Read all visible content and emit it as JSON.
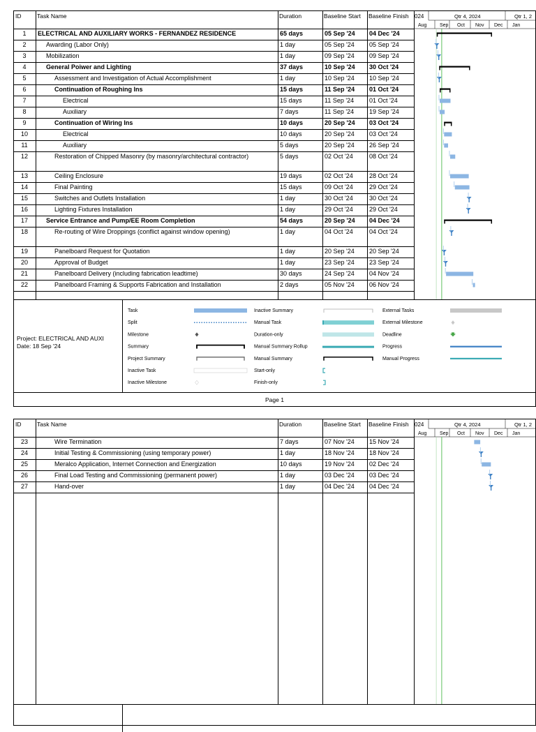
{
  "columns": {
    "id": "ID",
    "name": "Task Name",
    "duration": "Duration",
    "bstart": "Baseline Start",
    "bfinish": "Baseline Finish"
  },
  "timescale": {
    "top_left": "024",
    "top_mid": "Qtr 4, 2024",
    "top_right": "Qtr 1, 2",
    "months": [
      "Aug",
      "Sep",
      "Oct",
      "Nov",
      "Dec",
      "Jan"
    ]
  },
  "page1_tasks": [
    {
      "id": "1",
      "name": "ELECTRICAL AND AUXILIARY WORKS - FERNANDEZ RESIDENCE",
      "duration": "65 days",
      "bstart": "05 Sep '24",
      "bfinish": "04 Dec '24",
      "bold": true,
      "indent": 0
    },
    {
      "id": "2",
      "name": "Awarding (Labor Only)",
      "duration": "1 day",
      "bstart": "05 Sep '24",
      "bfinish": "05 Sep '24",
      "bold": false,
      "indent": 1
    },
    {
      "id": "3",
      "name": "Mobilization",
      "duration": "1 day",
      "bstart": "09 Sep '24",
      "bfinish": "09 Sep '24",
      "bold": false,
      "indent": 1
    },
    {
      "id": "4",
      "name": "General Poiwer and Lighting",
      "duration": "37 days",
      "bstart": "10 Sep '24",
      "bfinish": "30 Oct '24",
      "bold": true,
      "indent": 1
    },
    {
      "id": "5",
      "name": "Assessment and Investigation of Actual Accomplishment",
      "duration": "1 day",
      "bstart": "10 Sep '24",
      "bfinish": "10 Sep '24",
      "bold": false,
      "indent": 2
    },
    {
      "id": "6",
      "name": "Continuation of Roughing Ins",
      "duration": "15 days",
      "bstart": "11 Sep '24",
      "bfinish": "01 Oct '24",
      "bold": true,
      "indent": 2
    },
    {
      "id": "7",
      "name": "Electrical",
      "duration": "15 days",
      "bstart": "11 Sep '24",
      "bfinish": "01 Oct '24",
      "bold": false,
      "indent": 3
    },
    {
      "id": "8",
      "name": "Auxiliary",
      "duration": "7 days",
      "bstart": "11 Sep '24",
      "bfinish": "19 Sep '24",
      "bold": false,
      "indent": 3
    },
    {
      "id": "9",
      "name": "Continuation of Wiring Ins",
      "duration": "10 days",
      "bstart": "20 Sep '24",
      "bfinish": "03 Oct '24",
      "bold": true,
      "indent": 2
    },
    {
      "id": "10",
      "name": "Electrical",
      "duration": "10 days",
      "bstart": "20 Sep '24",
      "bfinish": "03 Oct '24",
      "bold": false,
      "indent": 3
    },
    {
      "id": "11",
      "name": "Auxiliary",
      "duration": "5 days",
      "bstart": "20 Sep '24",
      "bfinish": "26 Sep '24",
      "bold": false,
      "indent": 3
    },
    {
      "id": "12",
      "name": "Restoration of Chipped Masonry (by masonry/architectural contractor)",
      "duration": "5 days",
      "bstart": "02 Oct '24",
      "bfinish": "08 Oct '24",
      "bold": false,
      "indent": 2,
      "tall": true
    },
    {
      "id": "13",
      "name": "Ceiling Enclosure",
      "duration": "19 days",
      "bstart": "02 Oct '24",
      "bfinish": "28 Oct '24",
      "bold": false,
      "indent": 2
    },
    {
      "id": "14",
      "name": "Final Painting",
      "duration": "15 days",
      "bstart": "09 Oct '24",
      "bfinish": "29 Oct '24",
      "bold": false,
      "indent": 2
    },
    {
      "id": "15",
      "name": "Switches and Outlets Installation",
      "duration": "1 day",
      "bstart": "30 Oct '24",
      "bfinish": "30 Oct '24",
      "bold": false,
      "indent": 2
    },
    {
      "id": "16",
      "name": "Lighting Fixtures Installation",
      "duration": "1 day",
      "bstart": "29 Oct '24",
      "bfinish": "29 Oct '24",
      "bold": false,
      "indent": 2
    },
    {
      "id": "17",
      "name": "Service Entrance and Pump/EE Room Completion",
      "duration": "54 days",
      "bstart": "20 Sep '24",
      "bfinish": "04 Dec '24",
      "bold": true,
      "indent": 1
    },
    {
      "id": "18",
      "name": "Re-routing of Wire Droppings (conflict against window opening)",
      "duration": "1 day",
      "bstart": "04 Oct '24",
      "bfinish": "04 Oct '24",
      "bold": false,
      "indent": 2,
      "tall": true
    },
    {
      "id": "19",
      "name": "Panelboard Request for Quotation",
      "duration": "1 day",
      "bstart": "20 Sep '24",
      "bfinish": "20 Sep '24",
      "bold": false,
      "indent": 2
    },
    {
      "id": "20",
      "name": "Approval of Budget",
      "duration": "1 day",
      "bstart": "23 Sep '24",
      "bfinish": "23 Sep '24",
      "bold": false,
      "indent": 2
    },
    {
      "id": "21",
      "name": "Panelboard Delivery (including fabrication leadtime)",
      "duration": "30 days",
      "bstart": "24 Sep '24",
      "bfinish": "04 Nov '24",
      "bold": false,
      "indent": 2
    },
    {
      "id": "22",
      "name": "Panelboard Framing & Supports Fabrication and Installation",
      "duration": "2 days",
      "bstart": "05 Nov '24",
      "bfinish": "06 Nov '24",
      "bold": false,
      "indent": 2
    }
  ],
  "page2_tasks": [
    {
      "id": "23",
      "name": "Wire Termination",
      "duration": "7 days",
      "bstart": "07 Nov '24",
      "bfinish": "15 Nov '24",
      "bold": false,
      "indent": 2
    },
    {
      "id": "24",
      "name": "Initial Testing & Commissioning (using temporary power)",
      "duration": "1 day",
      "bstart": "18 Nov '24",
      "bfinish": "18 Nov '24",
      "bold": false,
      "indent": 2
    },
    {
      "id": "25",
      "name": "Meralco Application, Internet Connection and Energization",
      "duration": "10 days",
      "bstart": "19 Nov '24",
      "bfinish": "02 Dec '24",
      "bold": false,
      "indent": 2
    },
    {
      "id": "26",
      "name": "Final Load Testing and Commissioning (permanent power)",
      "duration": "1 day",
      "bstart": "03 Dec '24",
      "bfinish": "03 Dec '24",
      "bold": false,
      "indent": 2
    },
    {
      "id": "27",
      "name": "Hand-over",
      "duration": "1 day",
      "bstart": "04 Dec '24",
      "bfinish": "04 Dec '24",
      "bold": false,
      "indent": 2
    }
  ],
  "legend": {
    "project": "Project: ELECTRICAL AND AUXI",
    "date": "Date: 18 Sep '24",
    "col1": [
      "Task",
      "Split",
      "Milestone",
      "Summary",
      "Project Summary",
      "Inactive Task",
      "Inactive Milestone"
    ],
    "col2": [
      "Inactive Summary",
      "Manual Task",
      "Duration-only",
      "Manual Summary Rollup",
      "Manual Summary",
      "Start-only",
      "Finish-only"
    ],
    "col3": [
      "External Tasks",
      "External Milestone",
      "Deadline",
      "Progress",
      "Manual Progress"
    ]
  },
  "footer": "Page 1",
  "colors": {
    "task_bar": "#8cb6e3",
    "milestone": "#3b7fc4",
    "summary": "#000000",
    "today_line": "#5fbf5f",
    "link_line": "#9ec4ea",
    "teal": "#3aaab4"
  }
}
